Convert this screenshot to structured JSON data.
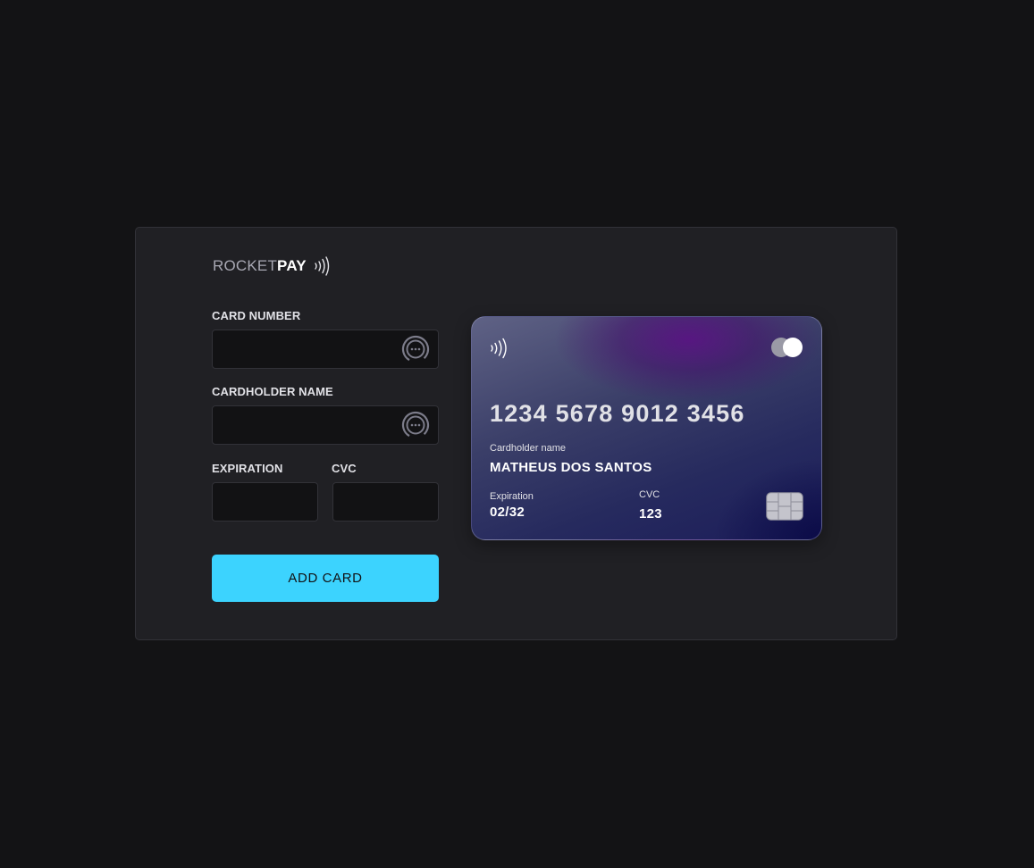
{
  "brand": {
    "name_light": "ROCKET",
    "name_bold": "PAY",
    "icon": "contactless-icon"
  },
  "form": {
    "card_number": {
      "label": "CARD NUMBER",
      "value": "",
      "placeholder": "",
      "icon": "autofill-icon"
    },
    "cardholder_name": {
      "label": "CARDHOLDER NAME",
      "value": "",
      "placeholder": "",
      "icon": "autofill-icon"
    },
    "expiration": {
      "label": "EXPIRATION",
      "value": "",
      "placeholder": ""
    },
    "cvc": {
      "label": "CVC",
      "value": "",
      "placeholder": ""
    },
    "submit_label": "ADD CARD"
  },
  "card_preview": {
    "number": "1234 5678 9012 3456",
    "holder_label": "Cardholder name",
    "holder": "MATHEUS DOS SANTOS",
    "expiration_label": "Expiration",
    "expiration": "02/32",
    "cvc_label": "CVC",
    "cvc": "123",
    "icons": [
      "contactless-icon",
      "card-brand-icon",
      "chip-icon"
    ]
  },
  "colors": {
    "page_bg": "#131315",
    "panel_bg": "#202024",
    "input_bg": "#121214",
    "accent": "#3cd3fe",
    "text": "#e1e1e6"
  }
}
